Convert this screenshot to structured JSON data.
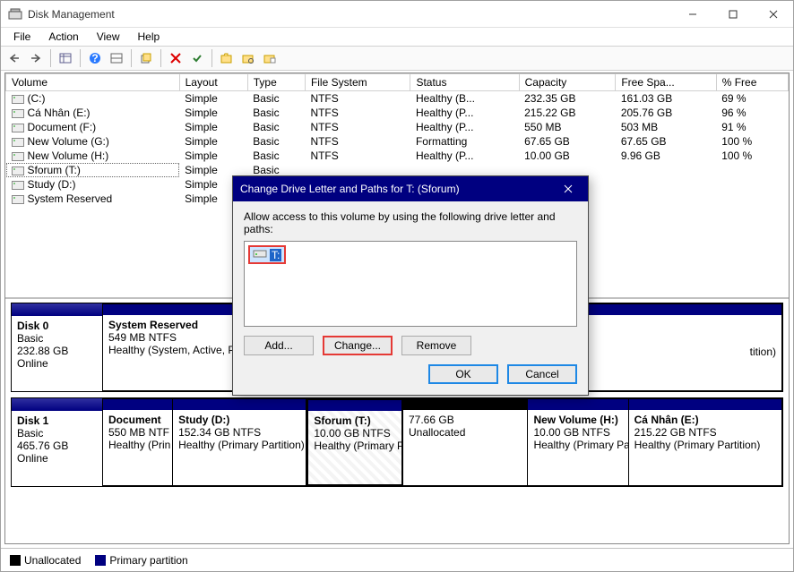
{
  "window": {
    "title": "Disk Management"
  },
  "menu": {
    "file": "File",
    "action": "Action",
    "view": "View",
    "help": "Help"
  },
  "columns": [
    "Volume",
    "Layout",
    "Type",
    "File System",
    "Status",
    "Capacity",
    "Free Spa...",
    "% Free"
  ],
  "volumes": [
    {
      "name": "(C:)",
      "layout": "Simple",
      "type": "Basic",
      "fs": "NTFS",
      "status": "Healthy (B...",
      "cap": "232.35 GB",
      "free": "161.03 GB",
      "pct": "69 %",
      "selected": false
    },
    {
      "name": "Cá Nhân (E:)",
      "layout": "Simple",
      "type": "Basic",
      "fs": "NTFS",
      "status": "Healthy (P...",
      "cap": "215.22 GB",
      "free": "205.76 GB",
      "pct": "96 %",
      "selected": false
    },
    {
      "name": "Document (F:)",
      "layout": "Simple",
      "type": "Basic",
      "fs": "NTFS",
      "status": "Healthy (P...",
      "cap": "550 MB",
      "free": "503 MB",
      "pct": "91 %",
      "selected": false
    },
    {
      "name": "New Volume (G:)",
      "layout": "Simple",
      "type": "Basic",
      "fs": "NTFS",
      "status": "Formatting",
      "cap": "67.65 GB",
      "free": "67.65 GB",
      "pct": "100 %",
      "selected": false
    },
    {
      "name": "New Volume (H:)",
      "layout": "Simple",
      "type": "Basic",
      "fs": "NTFS",
      "status": "Healthy (P...",
      "cap": "10.00 GB",
      "free": "9.96 GB",
      "pct": "100 %",
      "selected": false
    },
    {
      "name": "Sforum (T:)",
      "layout": "Simple",
      "type": "Basic",
      "fs": "",
      "status": "",
      "cap": "",
      "free": "",
      "pct": "",
      "selected": true
    },
    {
      "name": "Study (D:)",
      "layout": "Simple",
      "type": "Basic",
      "fs": "",
      "status": "",
      "cap": "",
      "free": "",
      "pct": "",
      "selected": false
    },
    {
      "name": "System Reserved",
      "layout": "Simple",
      "type": "Basic",
      "fs": "",
      "status": "",
      "cap": "",
      "free": "",
      "pct": "",
      "selected": false
    }
  ],
  "disk0": {
    "name": "Disk 0",
    "type": "Basic",
    "size": "232.88 GB",
    "state": "Online",
    "parts": [
      {
        "title": "System Reserved",
        "line2": "549 MB NTFS",
        "line3": "Healthy (System, Active, P",
        "width": "26%"
      },
      {
        "title": "",
        "line2": "",
        "line3": "",
        "width": "74%",
        "remainder": true,
        "endtext": "tition)"
      }
    ]
  },
  "disk1": {
    "name": "Disk 1",
    "type": "Basic",
    "size": "465.76 GB",
    "state": "Online",
    "parts": [
      {
        "title": "Document",
        "line2": "550 MB NTF",
        "line3": "Healthy (Prin",
        "width": "10.3%"
      },
      {
        "title": "Study  (D:)",
        "line2": "152.34 GB NTFS",
        "line3": "Healthy (Primary Partition)",
        "width": "19.7%"
      },
      {
        "title": "Sforum  (T:)",
        "line2": "10.00 GB NTFS",
        "line3": "Healthy (Primary Pa",
        "width": "14.2%",
        "selected": true
      },
      {
        "title": "",
        "line2": "77.66 GB",
        "line3": "Unallocated",
        "width": "18.4%",
        "unalloc": true
      },
      {
        "title": "New Volume  (H:)",
        "line2": "10.00 GB NTFS",
        "line3": "Healthy (Primary Pa",
        "width": "14.8%"
      },
      {
        "title": "Cá Nhân  (E:)",
        "line2": "215.22 GB NTFS",
        "line3": "Healthy (Primary Partition)",
        "width": "22.6%"
      }
    ]
  },
  "legend": {
    "unalloc": "Unallocated",
    "primary": "Primary partition"
  },
  "dialog": {
    "title": "Change Drive Letter and Paths for T: (Sforum)",
    "hint": "Allow access to this volume by using the following drive letter and paths:",
    "item_letter": "T:",
    "add": "Add...",
    "change": "Change...",
    "remove": "Remove",
    "ok": "OK",
    "cancel": "Cancel"
  }
}
